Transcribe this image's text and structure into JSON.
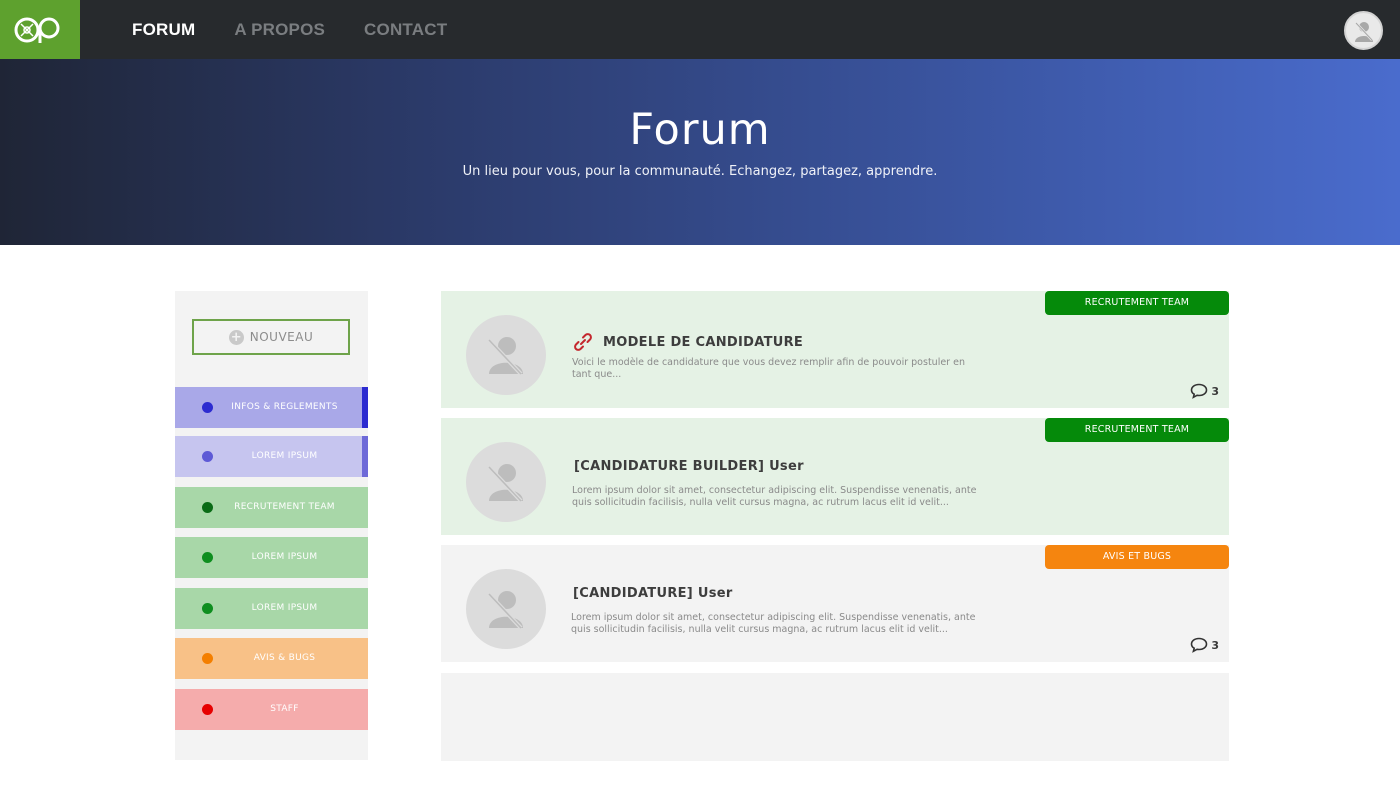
{
  "brand": {
    "logo_text": "OP",
    "accent_color": "#5ea12e"
  },
  "nav": {
    "items": [
      {
        "label": "FORUM",
        "active": true
      },
      {
        "label": "A PROPOS",
        "active": false
      },
      {
        "label": "CONTACT",
        "active": false
      }
    ]
  },
  "hero": {
    "title": "Forum",
    "subtitle": "Un lieu pour vous, pour la communauté. Echangez, partagez, apprendre."
  },
  "sidebar": {
    "new_button_label": "NOUVEAU",
    "categories": [
      {
        "label": "INFOS & REGLEMENTS",
        "bg": "#a9a8e8",
        "dot": "#2c2bd0",
        "edge": "#2c2bd0"
      },
      {
        "label": "LOREM IPSUM",
        "bg": "#c6c5ef",
        "dot": "#5e5ad6",
        "edge": "#6e6ad8"
      },
      {
        "label": "RECRUTEMENT TEAM",
        "bg": "#a8d7a8",
        "dot": "#0a6b16",
        "edge": ""
      },
      {
        "label": "LOREM IPSUM",
        "bg": "#a8d7a8",
        "dot": "#0e8e1f",
        "edge": ""
      },
      {
        "label": "LOREM IPSUM",
        "bg": "#a8d7a8",
        "dot": "#0e8e1f",
        "edge": ""
      },
      {
        "label": "AVIS & BUGS",
        "bg": "#f8c187",
        "dot": "#f47f00",
        "edge": ""
      },
      {
        "label": "STAFF",
        "bg": "#f5acac",
        "dot": "#e60000",
        "edge": ""
      }
    ]
  },
  "posts": [
    {
      "title": "MODELE DE CANDIDATURE",
      "has_link_icon": true,
      "excerpt": "Voici le modèle de candidature que vous devez remplir afin de pouvoir postuler en tant que...",
      "tag": "RECRUTEMENT TEAM",
      "tag_color": "#058a0a",
      "bg": "#e5f2e5",
      "comments": "3"
    },
    {
      "title": "[CANDIDATURE BUILDER] User",
      "has_link_icon": false,
      "excerpt": "Lorem ipsum dolor sit amet, consectetur adipiscing elit. Suspendisse venenatis, ante quis sollicitudin facilisis, nulla velit cursus magna, ac rutrum lacus elit id velit...",
      "tag": "RECRUTEMENT TEAM",
      "tag_color": "#058a0a",
      "bg": "#e5f2e5",
      "comments": ""
    },
    {
      "title": "[CANDIDATURE] User",
      "has_link_icon": false,
      "excerpt": "Lorem ipsum dolor sit amet, consectetur adipiscing elit. Suspendisse venenatis, ante quis sollicitudin facilisis, nulla velit cursus magna, ac rutrum lacus elit id velit...",
      "tag": "AVIS ET BUGS",
      "tag_color": "#f5850f",
      "bg": "#f3f3f3",
      "comments": "3"
    }
  ],
  "icons": {
    "user": "user-placeholder-icon",
    "link": "link-icon",
    "comment": "comment-bubble-icon",
    "plus": "plus-icon"
  }
}
